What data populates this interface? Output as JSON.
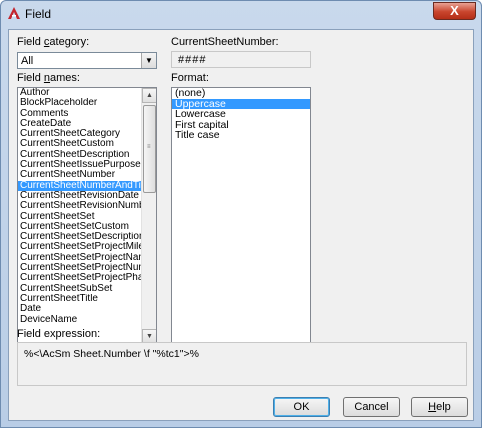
{
  "window": {
    "title": "Field",
    "close_glyph": "X",
    "app_icon": "autocad-a-icon"
  },
  "field_category": {
    "label_prefix": "Field ",
    "label_access": "c",
    "label_suffix": "ategory:",
    "selected": "All"
  },
  "field_names": {
    "label_prefix": "Field ",
    "label_access": "n",
    "label_suffix": "ames:",
    "selected_index": 9,
    "items": [
      "Author",
      "BlockPlaceholder",
      "Comments",
      "CreateDate",
      "CurrentSheetCategory",
      "CurrentSheetCustom",
      "CurrentSheetDescription",
      "CurrentSheetIssuePurpose",
      "CurrentSheetNumber",
      "CurrentSheetNumberAndTitle",
      "CurrentSheetRevisionDate",
      "CurrentSheetRevisionNumber",
      "CurrentSheetSet",
      "CurrentSheetSetCustom",
      "CurrentSheetSetDescription",
      "CurrentSheetSetProjectMilestone",
      "CurrentSheetSetProjectName",
      "CurrentSheetSetProjectNumber",
      "CurrentSheetSetProjectPhase",
      "CurrentSheetSubSet",
      "CurrentSheetTitle",
      "Date",
      "DeviceName"
    ]
  },
  "current_value": {
    "label": "CurrentSheetNumber:",
    "value": "####"
  },
  "format": {
    "label": "Format:",
    "selected_index": 1,
    "items": [
      "(none)",
      "Uppercase",
      "Lowercase",
      "First capital",
      "Title case"
    ]
  },
  "field_expression": {
    "label": "Field expression:",
    "value": "%<\\AcSm Sheet.Number \\f \"%tc1\">%"
  },
  "buttons": {
    "ok": "OK",
    "cancel": "Cancel",
    "help_access": "H",
    "help_rest": "elp"
  }
}
